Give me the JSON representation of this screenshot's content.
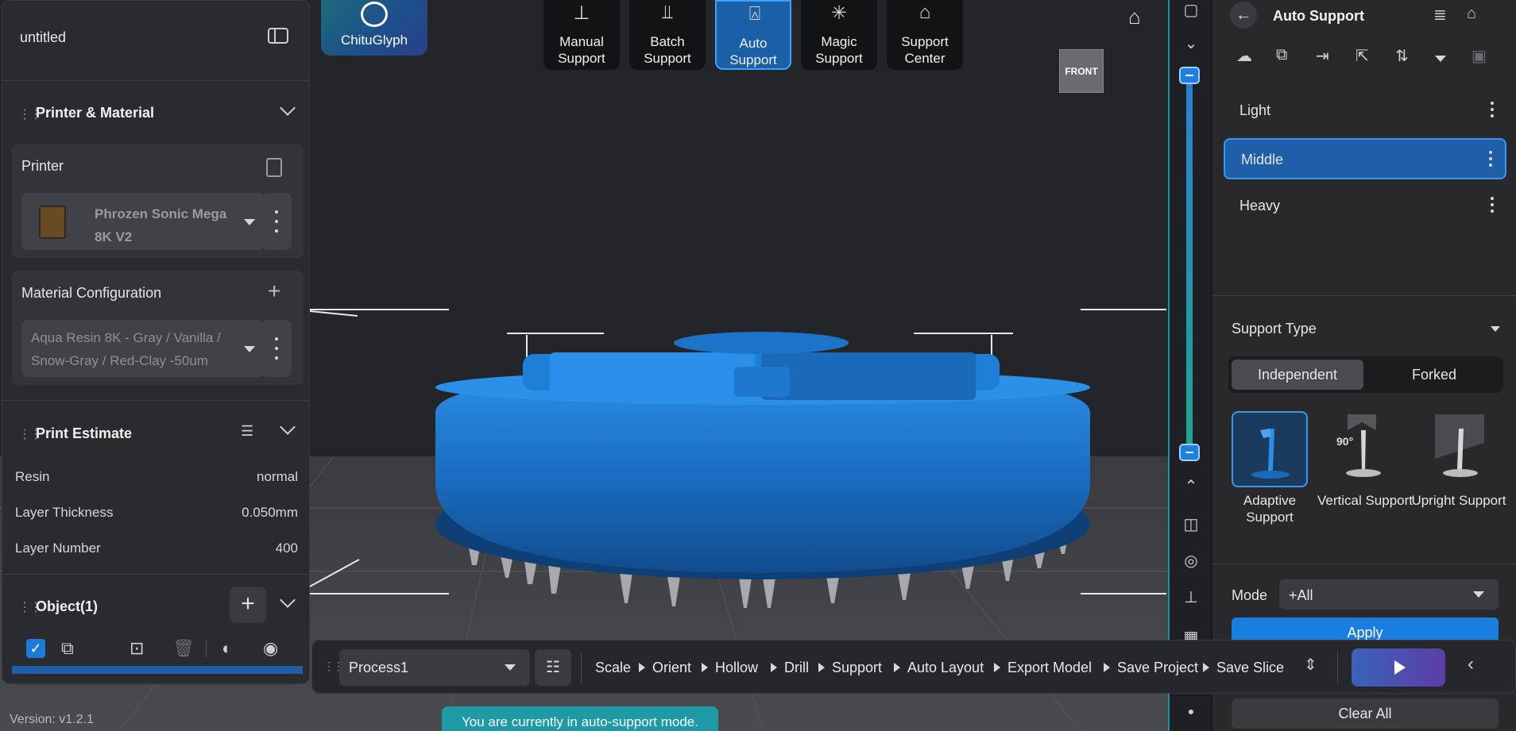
{
  "app": {
    "project_name": "untitled",
    "brand": "ChituGlyph",
    "version": "Version: v1.2.1",
    "toast": "You are currently in auto-support mode."
  },
  "left_panel": {
    "printer_material": {
      "title": "Printer & Material",
      "printer_label": "Printer",
      "printer_value": "Phrozen Sonic Mega 8K V2",
      "material_label": "Material Configuration",
      "material_value": "Aqua Resin 8K - Gray / Vanilla / Snow-Gray / Red-Clay -50um"
    },
    "print_estimate": {
      "title": "Print Estimate",
      "rows": [
        {
          "label": "Resin",
          "value": "normal"
        },
        {
          "label": "Layer Thickness",
          "value": "0.050mm"
        },
        {
          "label": "Layer Number",
          "value": "400"
        }
      ]
    },
    "objects": {
      "title": "Object(1)"
    }
  },
  "toolbar": {
    "tools": [
      {
        "label": "Manual Support",
        "icon": "manual-support-icon",
        "active": false
      },
      {
        "label": "Batch Support",
        "icon": "batch-support-icon",
        "active": false
      },
      {
        "label": "Auto Support",
        "icon": "auto-support-icon",
        "active": true
      },
      {
        "label": "Magic Support",
        "icon": "magic-wand-icon",
        "active": false
      },
      {
        "label": "Support Center",
        "icon": "support-center-icon",
        "active": false
      }
    ],
    "view_cube_label": "FRONT"
  },
  "right_panel": {
    "title": "Auto Support",
    "presets": [
      "Light",
      "Middle",
      "Heavy"
    ],
    "selected_preset": "Middle",
    "support_type_label": "Support Type",
    "structure_options": [
      "Independent",
      "Forked"
    ],
    "selected_structure": "Independent",
    "support_types": [
      {
        "label": "Adaptive Support",
        "selected": true
      },
      {
        "label": "Vertical Support",
        "selected": false,
        "badge": "90°"
      },
      {
        "label": "Upright Support",
        "selected": false
      }
    ],
    "mode_label": "Mode",
    "mode_value": "+All",
    "apply_label": "Apply",
    "clear_label": "Clear All"
  },
  "process_bar": {
    "process_value": "Process1",
    "steps": [
      "Scale",
      "Orient",
      "Hollow",
      "Drill",
      "Support",
      "Auto Layout",
      "Export Model",
      "Save Project",
      "Save Slice"
    ]
  },
  "colors": {
    "accent": "#1e5fa8",
    "accent_border": "#3b96f0",
    "model_blue": "#1f73c4",
    "toast": "#1e9aa6"
  }
}
